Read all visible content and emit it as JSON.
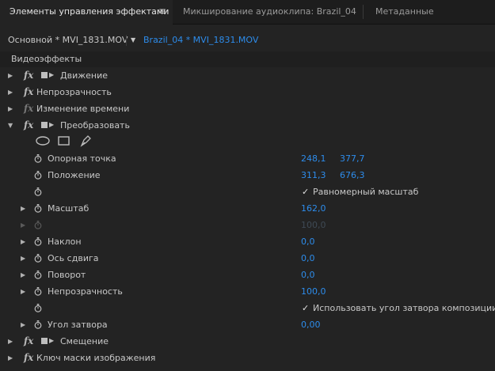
{
  "tabs": [
    {
      "label": "Элементы управления эффектами",
      "active": true
    },
    {
      "label": "Микширование аудиоклипа: Brazil_04",
      "active": false
    },
    {
      "label": "Метаданные",
      "active": false
    }
  ],
  "menu_icon": "≡",
  "clip": {
    "master": "Основной * MVI_1831.MOV",
    "sequence": "Brazil_04 * MVI_1831.MOV"
  },
  "section": {
    "label": "Видеоэффекты"
  },
  "effects": {
    "motion": "Движение",
    "opacity": "Непрозрачность",
    "time_remap": "Изменение времени",
    "transform": "Преобразовать",
    "offset": "Смещение",
    "image_matte": "Ключ маски изображения"
  },
  "params": {
    "anchor_point": {
      "label": "Опорная точка",
      "x": "248,1",
      "y": "377,7"
    },
    "position": {
      "label": "Положение",
      "x": "311,3",
      "y": "676,3"
    },
    "uniform_scale": {
      "label": "Равномерный масштаб",
      "checked": "✓"
    },
    "scale": {
      "label": "Масштаб",
      "value": "162,0"
    },
    "scale_width": {
      "value": "100,0"
    },
    "skew": {
      "label": "Наклон",
      "value": "0,0"
    },
    "skew_axis": {
      "label": "Ось сдвига",
      "value": "0,0"
    },
    "rotation": {
      "label": "Поворот",
      "value": "0,0"
    },
    "opacity": {
      "label": "Непрозрачность",
      "value": "100,0"
    },
    "use_comp_shutter": {
      "label": "Использовать угол затвора композиции",
      "checked": "✓"
    },
    "shutter_angle": {
      "label": "Угол затвора",
      "value": "0,00"
    }
  },
  "colors": {
    "accent": "#2d8ceb",
    "background": "#232323",
    "tabbar": "#1d1d1d"
  }
}
